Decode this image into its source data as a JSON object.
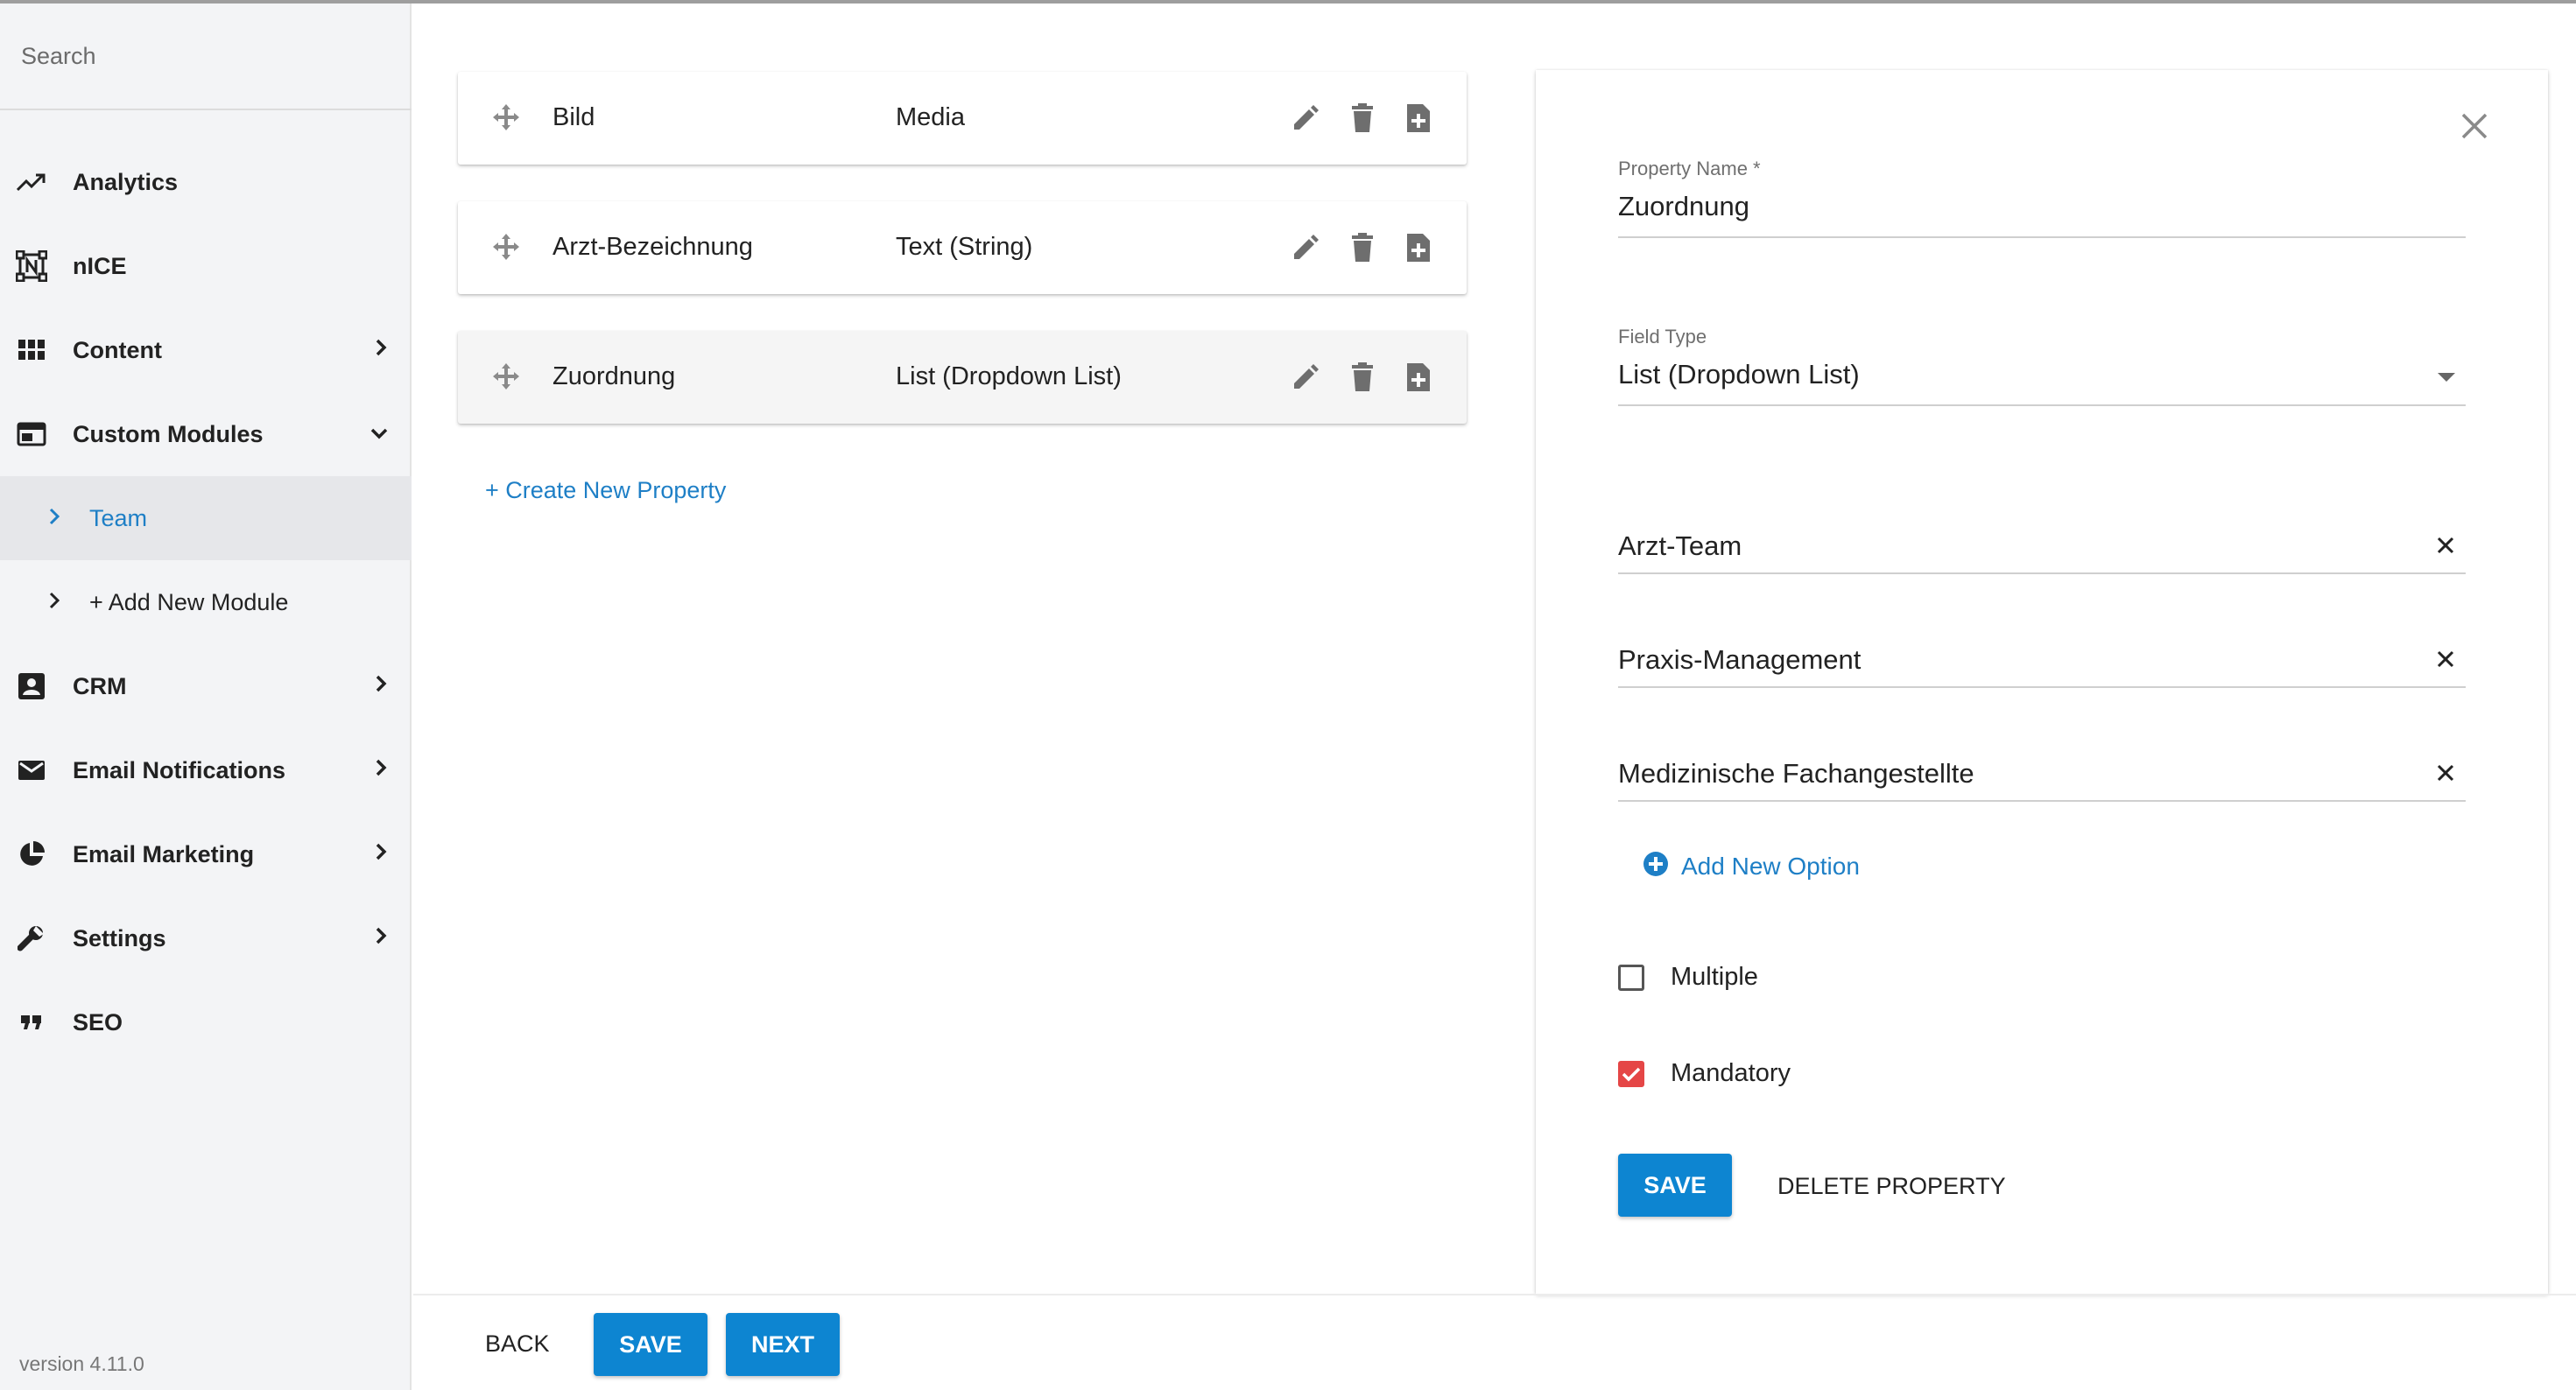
{
  "sidebar": {
    "search_placeholder": "Search",
    "items": [
      {
        "label": "Analytics"
      },
      {
        "label": "nICE"
      },
      {
        "label": "Content"
      },
      {
        "label": "Custom Modules"
      },
      {
        "label": "CRM"
      },
      {
        "label": "Email Notifications"
      },
      {
        "label": "Email Marketing"
      },
      {
        "label": "Settings"
      },
      {
        "label": "SEO"
      }
    ],
    "sub_items": [
      {
        "label": "Team",
        "active": true
      },
      {
        "label": "+ Add New Module",
        "active": false
      }
    ],
    "version": "version 4.11.0"
  },
  "properties": [
    {
      "name": "Bild",
      "type": "Media"
    },
    {
      "name": "Arzt-Bezeichnung",
      "type": "Text (String)"
    },
    {
      "name": "Zuordnung",
      "type": "List (Dropdown List)"
    }
  ],
  "create_property_label": "+ Create New Property",
  "bottom_bar": {
    "back_label": "BACK",
    "save_label": "SAVE",
    "next_label": "NEXT"
  },
  "panel": {
    "property_name_label": "Property Name *",
    "property_name_value": "Zuordnung",
    "field_type_label": "Field Type",
    "field_type_value": "List (Dropdown List)",
    "options": [
      "Arzt-Team",
      "Praxis-Management",
      "Medizinische Fachangestellte"
    ],
    "add_option_label": "Add New Option",
    "multiple_label": "Multiple",
    "multiple_checked": false,
    "mandatory_label": "Mandatory",
    "mandatory_checked": true,
    "save_label": "SAVE",
    "delete_label": "DELETE PROPERTY"
  },
  "colors": {
    "accent": "#0d85d1",
    "link": "#1e7fc6",
    "checkbox_checked": "#e54646",
    "sidebar_bg": "#f3f4f6"
  }
}
